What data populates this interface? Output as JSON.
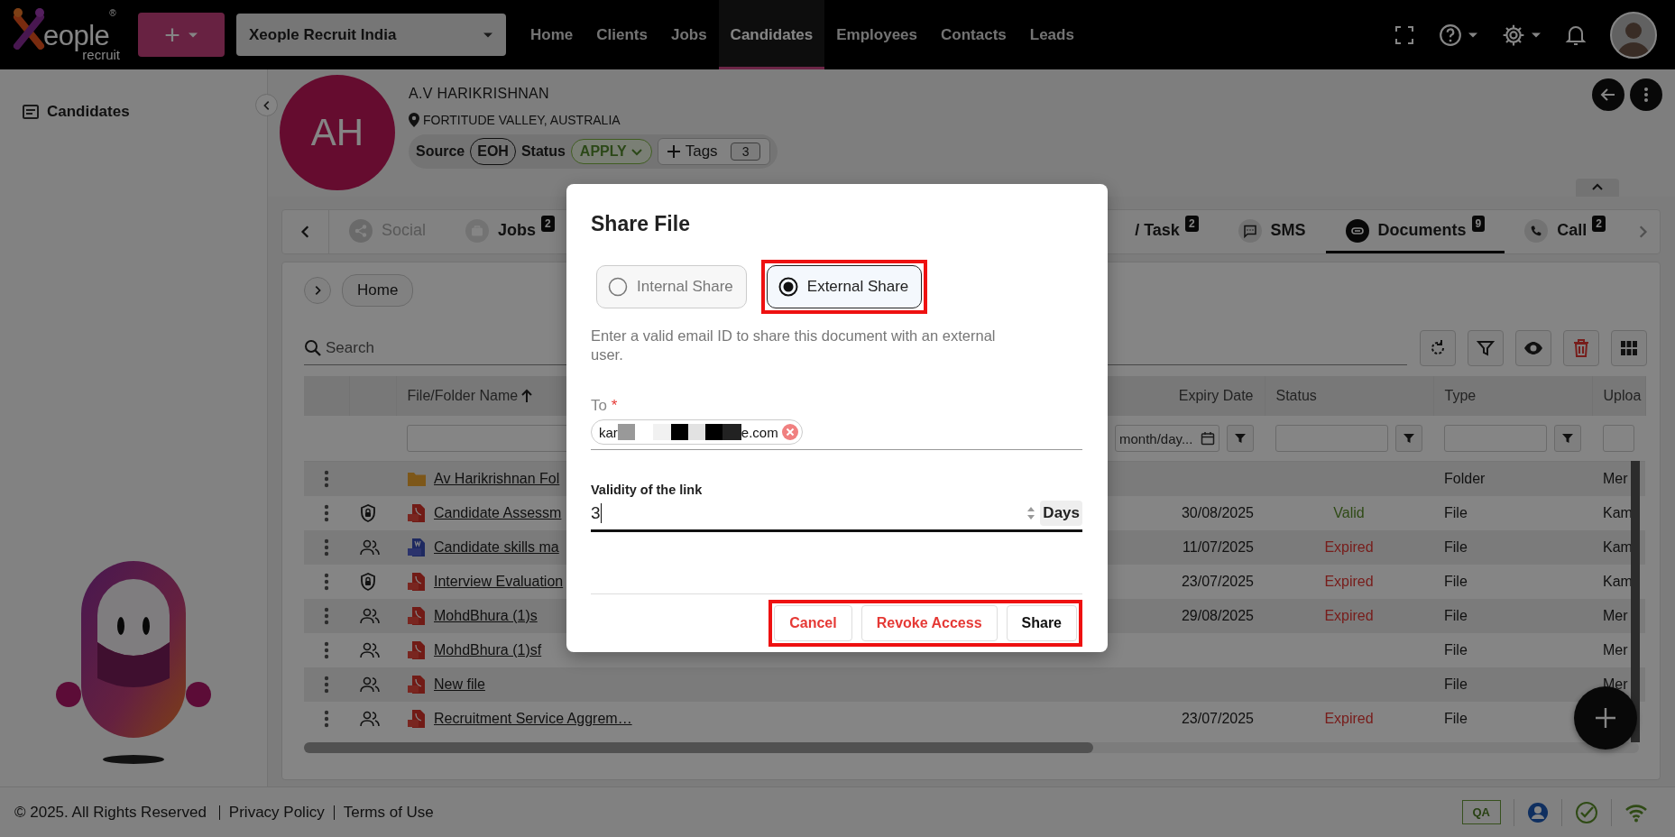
{
  "header": {
    "logo": {
      "wordmark": "eople",
      "registered": "®",
      "tagline": "recruit"
    },
    "add_button": "+",
    "company": "Xeople Recruit India",
    "nav": [
      {
        "label": "Home",
        "selected": false
      },
      {
        "label": "Clients",
        "selected": false
      },
      {
        "label": "Jobs",
        "selected": false
      },
      {
        "label": "Candidates",
        "selected": true
      },
      {
        "label": "Employees",
        "selected": false
      },
      {
        "label": "Contacts",
        "selected": false
      },
      {
        "label": "Leads",
        "selected": false
      }
    ]
  },
  "sidebar": {
    "items": [
      {
        "label": "Candidates"
      }
    ]
  },
  "candidate": {
    "initials": "AH",
    "name": "A.V HARIKRISHNAN",
    "location": "FORTITUDE VALLEY, AUSTRALIA",
    "source_label": "Source",
    "source": "EOH",
    "status_label": "Status",
    "status": "APPLY",
    "tags_label": "Tags",
    "tags_count": "3"
  },
  "tabs": [
    {
      "label": "Social",
      "kind": "share",
      "disabled": true,
      "selected": false
    },
    {
      "label": "Jobs",
      "kind": "briefcase",
      "count": "2",
      "disabled": false,
      "selected": false
    },
    {
      "label": "/ Task",
      "count": "2",
      "disabled": false,
      "selected": false
    },
    {
      "label": "SMS",
      "kind": "message",
      "disabled": false,
      "selected": false
    },
    {
      "label": "Documents",
      "kind": "clip",
      "count": "9",
      "disabled": false,
      "selected": true
    },
    {
      "label": "Call",
      "kind": "phone",
      "count": "2",
      "disabled": false,
      "selected": false
    }
  ],
  "documents": {
    "breadcrumb": "Home",
    "search": {
      "placeholder": "Search"
    },
    "columns": {
      "name": "File/Folder Name",
      "expiry": "Expiry Date",
      "status": "Status",
      "type": "Type",
      "column_8": "Uploa"
    },
    "expiry_filter_placeholder": "month/day...",
    "rows": [
      {
        "file_icon": {
          "kind": "folder"
        },
        "name": "Av Harikrishnan Fol",
        "type": "Folder",
        "uploader": "Mer"
      },
      {
        "share_icon": {
          "kind": "lock"
        },
        "file_icon": {
          "kind": "pdf"
        },
        "name": "Candidate Assessm",
        "expiry": "30/08/2025",
        "status": {
          "text": "Valid",
          "kind": "valid"
        },
        "type": "File",
        "uploader": "Kam"
      },
      {
        "share_icon": {
          "kind": "people"
        },
        "file_icon": {
          "kind": "docx"
        },
        "name": "Candidate skills ma",
        "expiry": "11/07/2025",
        "status": {
          "text": "Expired",
          "kind": "expired"
        },
        "type": "File",
        "uploader": "Kam"
      },
      {
        "share_icon": {
          "kind": "lock"
        },
        "file_icon": {
          "kind": "pdf"
        },
        "name": "Interview Evaluation",
        "expiry": "23/07/2025",
        "status": {
          "text": "Expired",
          "kind": "expired"
        },
        "type": "File",
        "uploader": "Kam"
      },
      {
        "share_icon": {
          "kind": "people"
        },
        "file_icon": {
          "kind": "pdf"
        },
        "name": "MohdBhura (1)s",
        "expiry": "29/08/2025",
        "status": {
          "text": "Expired",
          "kind": "expired"
        },
        "type": "File",
        "uploader": "Mer"
      },
      {
        "share_icon": {
          "kind": "people"
        },
        "file_icon": {
          "kind": "pdf"
        },
        "name": "MohdBhura (1)sf",
        "type": "File",
        "uploader": "Mer"
      },
      {
        "share_icon": {
          "kind": "people"
        },
        "file_icon": {
          "kind": "pdf"
        },
        "name": "New file",
        "type": "File",
        "uploader": "Mer"
      },
      {
        "share_icon": {
          "kind": "people"
        },
        "file_icon": {
          "kind": "pdf"
        },
        "name": "Recruitment Service Aggrem…",
        "expiry": "23/07/2025",
        "status": {
          "text": "Expired",
          "kind": "expired"
        },
        "type": "File"
      }
    ]
  },
  "dialog": {
    "title": "Share File",
    "options": [
      {
        "label": "Internal Share",
        "selected": false,
        "highlighted": false
      },
      {
        "label": "External Share",
        "selected": true,
        "highlighted": true
      }
    ],
    "hint": "Enter a valid email ID to share this document with an external user.",
    "to_label": "To",
    "required_mark": "*",
    "recipients": [
      {
        "prefix": "kar",
        "suffix": "e.com"
      }
    ],
    "validity_label": "Validity of the link",
    "validity_value": "3",
    "validity_unit": "Days",
    "buttons": [
      {
        "label": "Cancel",
        "kind": "cancel"
      },
      {
        "label": "Revoke Access",
        "kind": "revoke"
      },
      {
        "label": "Share",
        "kind": "primary"
      }
    ],
    "buttons_highlighted": true
  },
  "footer": {
    "copyright": "© 2025. All Rights Reserved",
    "links": [
      "Privacy Policy",
      "Terms of Use"
    ],
    "env_badge": "QA"
  }
}
